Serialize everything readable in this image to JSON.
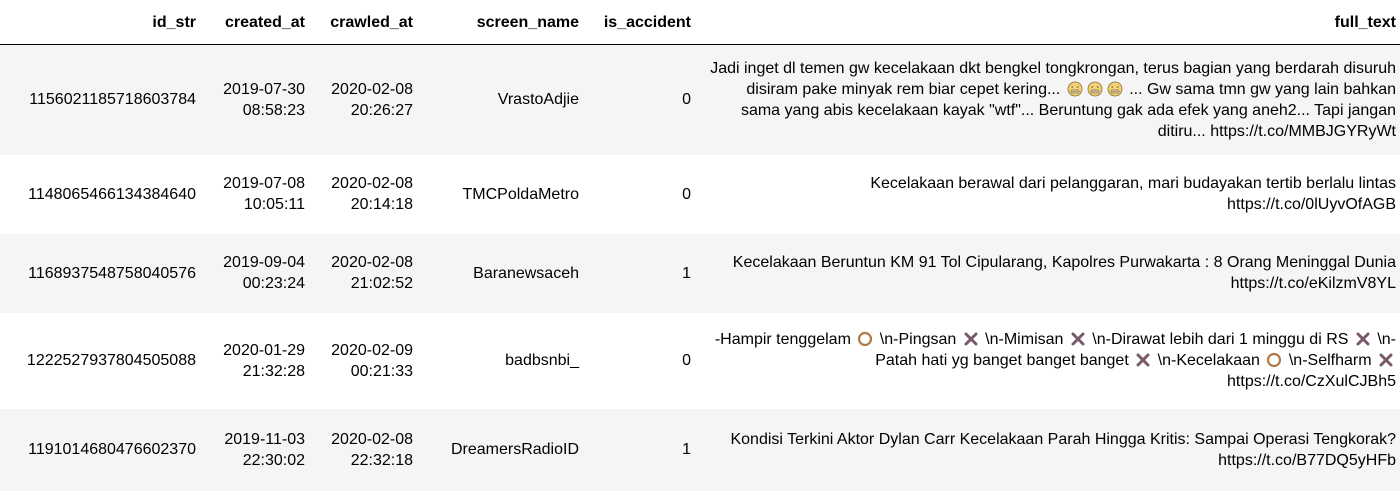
{
  "table": {
    "columns": [
      "id_str",
      "created_at",
      "crawled_at",
      "screen_name",
      "is_accident",
      "full_text"
    ],
    "rows": [
      {
        "id_str": "1156021185718603784",
        "created_at": "2019-07-30 08:58:23",
        "crawled_at": "2020-02-08 20:26:27",
        "screen_name": "VrastoAdjie",
        "is_accident": "0",
        "full_text": [
          {
            "t": "Jadi inget dl temen gw kecelakaan dkt bengkel tongkrongan, terus bagian yang berdarah disuruh disiram pake minyak rem biar cepet kering... "
          },
          {
            "icon": "grimace-emoji-icon"
          },
          {
            "icon": "grimace-emoji-icon"
          },
          {
            "icon": "grimace-emoji-icon"
          },
          {
            "t": " ... Gw sama tmn gw yang lain bahkan sama yang abis kecelakaan kayak \"wtf\"... Beruntung gak ada efek yang aneh2... Tapi jangan ditiru... https://t.co/MMBJGYRyWt"
          }
        ]
      },
      {
        "id_str": "1148065466134384640",
        "created_at": "2019-07-08 10:05:11",
        "crawled_at": "2020-02-08 20:14:18",
        "screen_name": "TMCPoldaMetro",
        "is_accident": "0",
        "full_text": [
          {
            "t": "Kecelakaan berawal dari pelanggaran, mari budayakan tertib berlalu lintas https://t.co/0lUyvOfAGB"
          }
        ]
      },
      {
        "id_str": "1168937548758040576",
        "created_at": "2019-09-04 00:23:24",
        "crawled_at": "2020-02-08 21:02:52",
        "screen_name": "Baranewsaceh",
        "is_accident": "1",
        "full_text": [
          {
            "t": "Kecelakaan Beruntun KM 91 Tol Cipularang, Kapolres Purwakarta : 8 Orang Meninggal Dunia https://t.co/eKilzmV8YL"
          }
        ]
      },
      {
        "id_str": "1222527937804505088",
        "created_at": "2020-01-29 21:32:28",
        "crawled_at": "2020-02-09 00:21:33",
        "screen_name": "badbsnbi_",
        "is_accident": "0",
        "full_text": [
          {
            "t": "-Hampir tenggelam "
          },
          {
            "icon": "circle-emoji-icon"
          },
          {
            "t": " \\n-Pingsan "
          },
          {
            "icon": "cross-mark-emoji-icon"
          },
          {
            "t": " \\n-Mimisan "
          },
          {
            "icon": "cross-mark-emoji-icon"
          },
          {
            "t": " \\n-Dirawat lebih dari 1 minggu di RS "
          },
          {
            "icon": "cross-mark-emoji-icon"
          },
          {
            "t": " \\n-Patah hati yg banget banget banget "
          },
          {
            "icon": "cross-mark-emoji-icon"
          },
          {
            "t": "  \\n-Kecelakaan "
          },
          {
            "icon": "circle-emoji-icon"
          },
          {
            "t": " \\n-Selfharm "
          },
          {
            "icon": "cross-mark-emoji-icon"
          },
          {
            "t": " https://t.co/CzXulCJBh5"
          }
        ]
      },
      {
        "id_str": "1191014680476602370",
        "created_at": "2019-11-03 22:30:02",
        "crawled_at": "2020-02-08 22:32:18",
        "screen_name": "DreamersRadioID",
        "is_accident": "1",
        "full_text": [
          {
            "t": "Kondisi Terkini Aktor Dylan Carr Kecelakaan Parah Hingga Kritis: Sampai Operasi Tengkorak? https://t.co/B77DQ5yHFb"
          }
        ]
      }
    ]
  },
  "icons": {
    "grimace-emoji-icon": {
      "face": "#f4d27a",
      "stroke": "#8a6d2f"
    },
    "circle-emoji-icon": {
      "stroke": "#b07a45"
    },
    "cross-mark-emoji-icon": {
      "stroke": "#7a5a6a"
    }
  }
}
